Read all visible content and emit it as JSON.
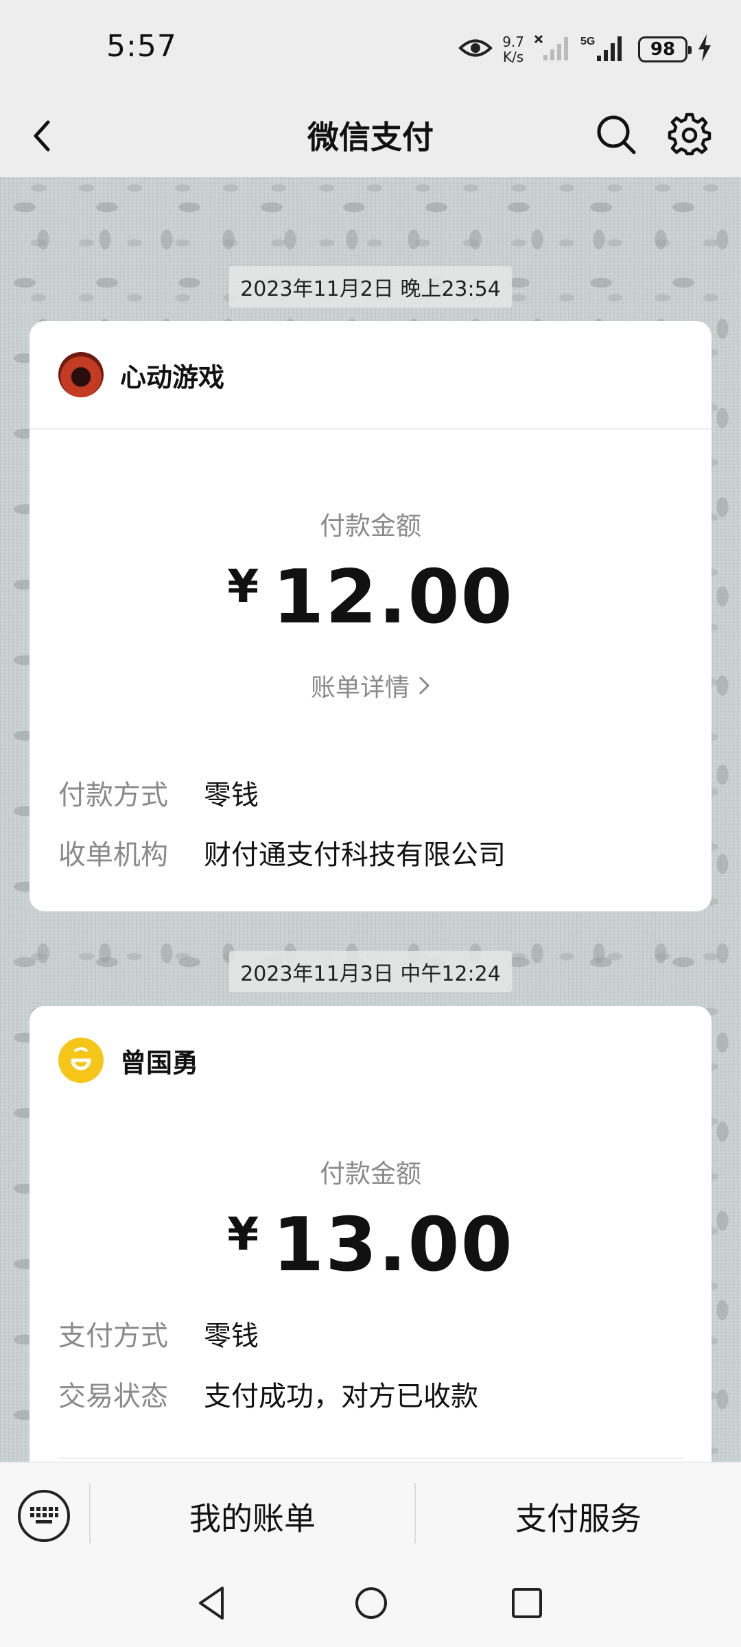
{
  "status_bar": {
    "time": "5:57",
    "net_speed_value": "9.7",
    "net_speed_unit": "K/s",
    "network_type": "5G",
    "battery": "98"
  },
  "nav": {
    "title": "微信支付",
    "icons": [
      "back-icon",
      "search-icon",
      "gear-icon"
    ]
  },
  "messages": [
    {
      "timestamp": "2023年11月2日 晚上23:54",
      "merchant": "心动游戏",
      "amount_label": "付款金额",
      "currency": "¥",
      "amount": "12.00",
      "bill_detail": "账单详情",
      "rows": [
        {
          "label": "付款方式",
          "value": "零钱"
        },
        {
          "label": "收单机构",
          "value": "财付通支付科技有限公司"
        }
      ]
    },
    {
      "timestamp": "2023年11月3日 中午12:24",
      "merchant": "曾国勇",
      "amount_label": "付款金额",
      "currency": "¥",
      "amount": "13.00",
      "rows": [
        {
          "label": "支付方式",
          "value": "零钱"
        },
        {
          "label": "交易状态",
          "value": "支付成功，对方已收款"
        }
      ]
    }
  ],
  "bottom_menu": {
    "items": [
      "我的账单",
      "支付服务"
    ]
  },
  "colors": {
    "background": "#ededed",
    "card": "#ffffff",
    "label_gray": "#8a8a8a",
    "text": "#111111",
    "avatar_yellow": "#f5c518"
  }
}
